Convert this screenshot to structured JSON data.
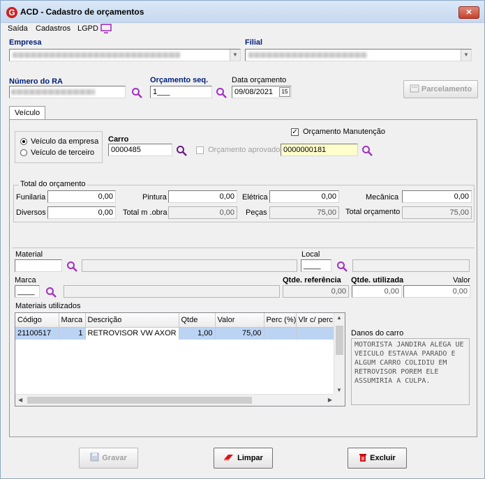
{
  "window": {
    "title": "ACD - Cadastro de orçamentos",
    "close_label": "✕"
  },
  "menu": {
    "saida": "Saída",
    "cadastros": "Cadastros",
    "lgpd": "LGPD"
  },
  "empresa": {
    "label": "Empresa"
  },
  "filial": {
    "label": "Filial"
  },
  "numero_ra": {
    "label": "Número do RA"
  },
  "orcamento_seq": {
    "label": "Orçamento seq.",
    "value": "1___"
  },
  "data_orcamento": {
    "label": "Data orçamento",
    "value": "09/08/2021",
    "cal_label": "15"
  },
  "parcelamento": {
    "label": "Parcelamento"
  },
  "tabs": {
    "veiculo": "Veículo"
  },
  "vehicle_radio": {
    "empresa": "Veículo da empresa",
    "terceiro": "Veículo de terceiro",
    "selected": "empresa"
  },
  "carro": {
    "label": "Carro",
    "value": "0000485"
  },
  "orcamento_manutencao": {
    "label": "Orçamento Manutenção",
    "checked": true
  },
  "orcamento_aprovado": {
    "label": "Orçamento aprovado",
    "checked": false,
    "value": "0000000181"
  },
  "total_group": {
    "title": "Total do orçamento",
    "funilaria_label": "Funilaria",
    "funilaria": "0,00",
    "pintura_label": "Pintura",
    "pintura": "0,00",
    "eletrica_label": "Elétrica",
    "eletrica": "0,00",
    "mecanica_label": "Mecânica",
    "mecanica": "0,00",
    "diversos_label": "Diversos",
    "diversos": "0,00",
    "total_mobra_label": "Total m .obra",
    "total_mobra": "0,00",
    "pecas_label": "Peças",
    "pecas": "75,00",
    "total_orcamento_label": "Total orçamento",
    "total_orcamento": "75,00"
  },
  "material": {
    "label": "Material",
    "local_label": "Local",
    "local_value": "____"
  },
  "marca": {
    "label": "Marca",
    "value": "____"
  },
  "qtde": {
    "referencia_label": "Qtde. referência",
    "referencia": "0,00",
    "utilizada_label": "Qtde. utilizada",
    "utilizada": "0,00",
    "valor_label": "Valor",
    "valor": "0,00"
  },
  "materiais": {
    "label": "Materiais utilizados",
    "columns": [
      "Código",
      "Marca",
      "Descrição",
      "Qtde",
      "Valor",
      "Perc (%)",
      "Vlr c/ perc"
    ],
    "rows": [
      {
        "codigo": "21100517",
        "marca": "1",
        "descricao": "RETROVISOR VW AXOR",
        "qtde": "1,00",
        "valor": "75,00",
        "perc": "",
        "vlr": ""
      }
    ]
  },
  "danos": {
    "label": "Danos do carro",
    "text": "MOTORISTA JANDIRA ALEGA UE VEICULO ESTAVAA PARADO E ALGUM CARRO COLIDIU EM RETROVISOR POREM ELE ASSUMIRIA A CULPA."
  },
  "buttons": {
    "gravar": "Gravar",
    "limpar": "Limpar",
    "excluir": "Excluir"
  },
  "colors": {
    "accent": "#00207a",
    "magnifier": "#a030c0",
    "highlight_field": "#ffffcc",
    "row_select": "#bcd4f4"
  }
}
